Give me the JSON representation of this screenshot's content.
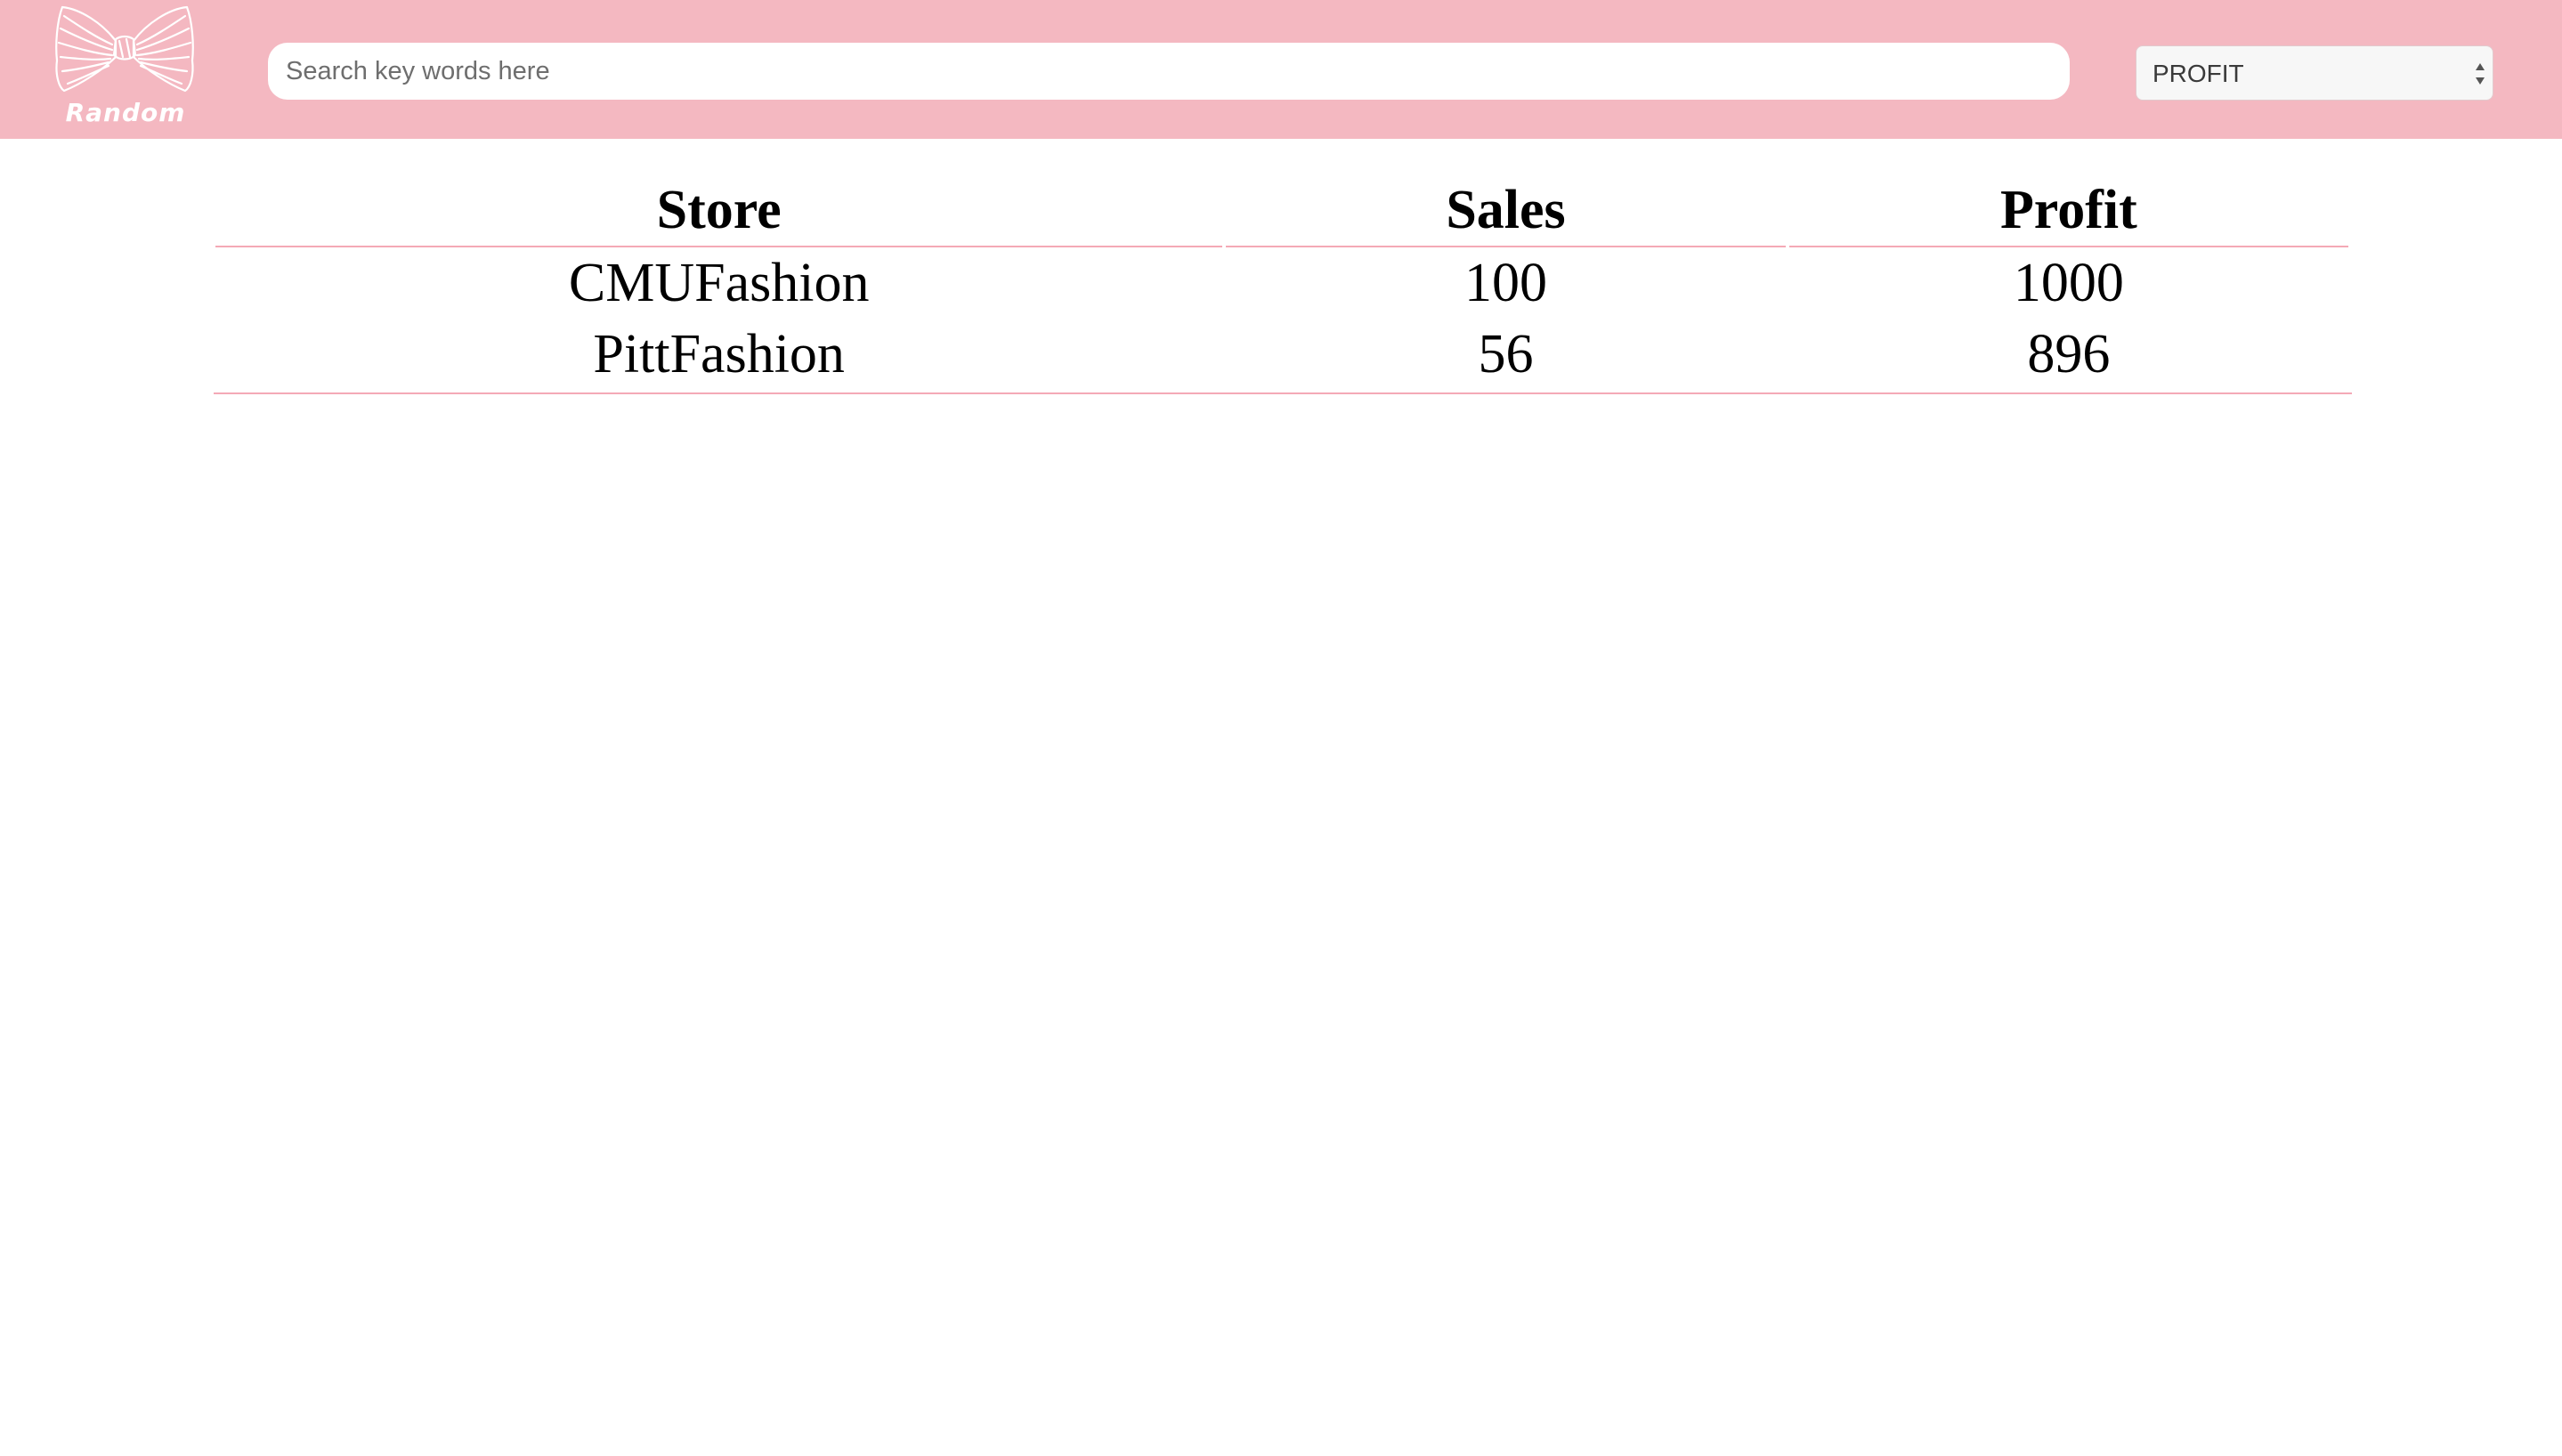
{
  "header": {
    "logo_text": "Random",
    "background_color": "#f4b8c1",
    "search": {
      "placeholder": "Search key words here",
      "value": ""
    },
    "sort_select": {
      "selected": "PROFIT",
      "icon": "select-arrows-icon"
    }
  },
  "table": {
    "columns": [
      "Store",
      "Sales",
      "Profit"
    ],
    "rows": [
      {
        "store": "CMUFashion",
        "sales": "100",
        "profit": "1000"
      },
      {
        "store": "PittFashion",
        "sales": "56",
        "profit": "896"
      }
    ],
    "rule_color": "#f4a9b6"
  }
}
